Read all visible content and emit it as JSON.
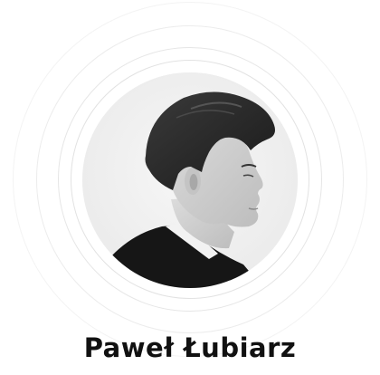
{
  "profile": {
    "name": "Paweł Łubiarz",
    "photo_style": "grayscale portrait in circular frame",
    "ring_color": "#e6e6e6",
    "text_color": "#111111"
  }
}
